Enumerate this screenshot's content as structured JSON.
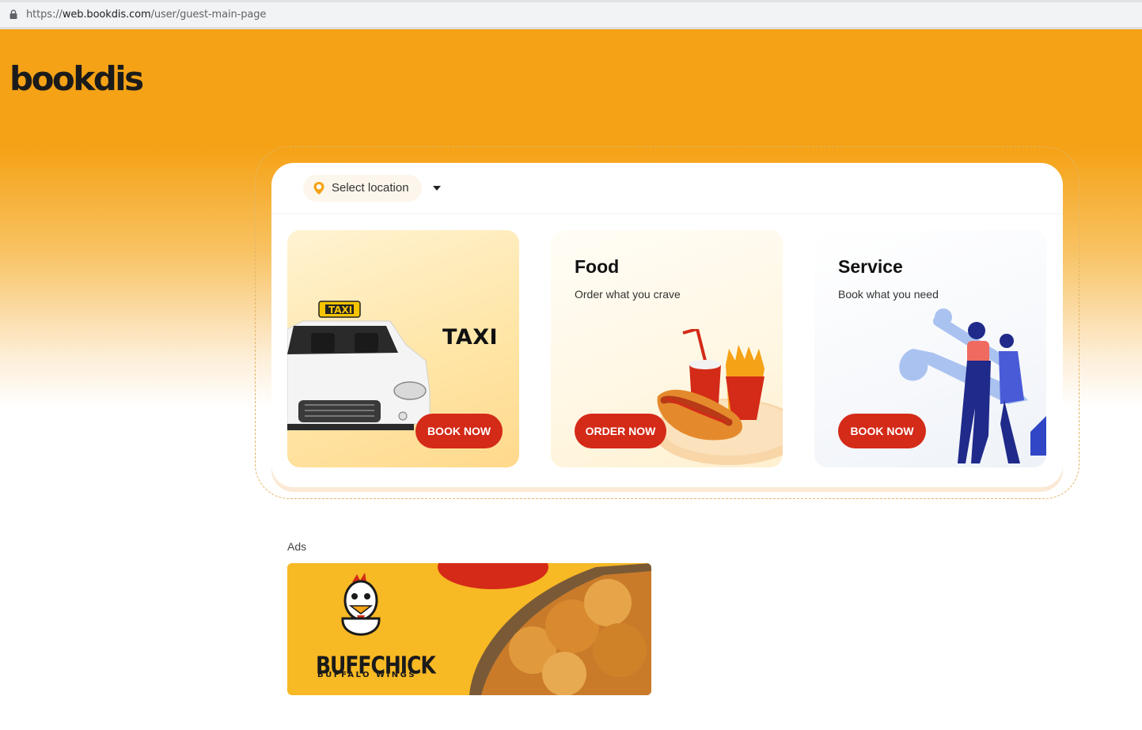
{
  "browser": {
    "url_scheme": "https://",
    "url_domain": "web.bookdis.com",
    "url_path": "/user/guest-main-page",
    "lock_icon": "lock-icon"
  },
  "brand": {
    "logo_text": "bookdis"
  },
  "location": {
    "label": "Select location",
    "icon": "location-pin-icon"
  },
  "cards": {
    "taxi": {
      "image_text": "TAXI",
      "sign_text": "TAXI",
      "button": "BOOK NOW"
    },
    "food": {
      "title": "Food",
      "subtitle": "Order what you crave",
      "button": "ORDER NOW"
    },
    "service": {
      "title": "Service",
      "subtitle": "Book what you need",
      "button": "BOOK NOW"
    }
  },
  "ads": {
    "label": "Ads",
    "banner_brand": "BUFFCHICK",
    "banner_subtitle": "BUFFALO WINGS"
  },
  "colors": {
    "brand_orange": "#f5a216",
    "button_red": "#d42a18",
    "text_dark": "#111111"
  }
}
